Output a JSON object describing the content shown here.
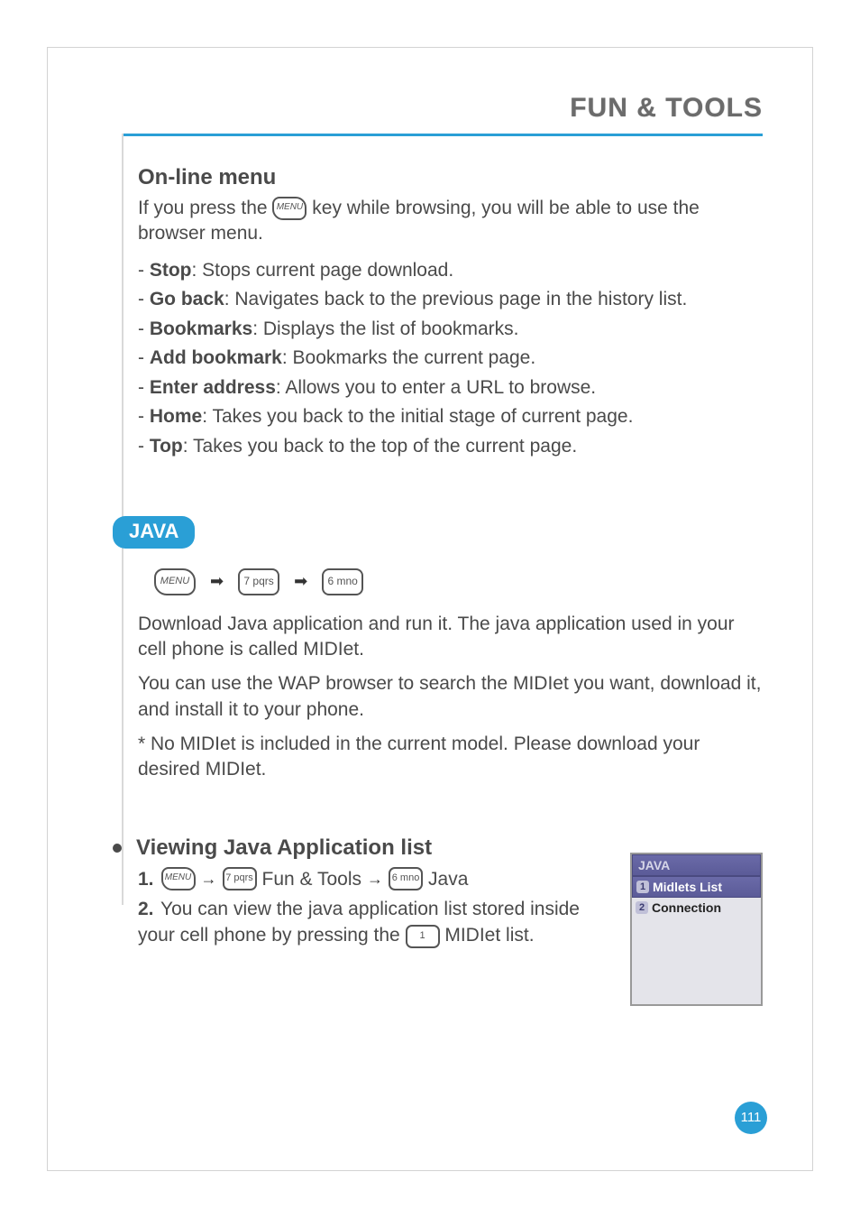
{
  "header": {
    "title": "FUN & TOOLS"
  },
  "online_menu": {
    "title": "On-line menu",
    "intro_before": "If you press the ",
    "intro_key": "MENU",
    "intro_after": " key while browsing, you will be able to use the browser menu.",
    "items": [
      {
        "name": "Stop",
        "desc": ": Stops current page download."
      },
      {
        "name": "Go back",
        "desc": ": Navigates back to the previous page in the history list."
      },
      {
        "name": "Bookmarks",
        "desc": ": Displays the list of bookmarks."
      },
      {
        "name": "Add bookmark",
        "desc": ": Bookmarks the current page."
      },
      {
        "name": "Enter address",
        "desc": ": Allows you to enter a URL to browse."
      },
      {
        "name": "Home",
        "desc": ": Takes you back to the initial stage of current page."
      },
      {
        "name": "Top",
        "desc": ": Takes you back to the top of the current page."
      }
    ]
  },
  "java": {
    "label": "JAVA",
    "keys": {
      "menu": "MENU",
      "k7": "7 pqrs",
      "k6": "6 mno"
    },
    "p1": "Download Java application and run it. The java application used in your cell phone is called MIDIet.",
    "p2": "You can use the WAP browser to search the MIDIet you want, download it, and install it to your phone.",
    "p3": "* No MIDIet is included in the current model. Please download your desired MIDIet."
  },
  "viewing": {
    "title": "Viewing Java Application list",
    "step1": {
      "num": "1.",
      "key_menu": "MENU",
      "arrow1": "→",
      "key7": "7 pqrs",
      "label1": "Fun & Tools",
      "arrow2": "→",
      "key6": "6 mno",
      "label2": "Java"
    },
    "step2": {
      "num": "2.",
      "before": "You can view the java application list stored inside your cell phone by pressing the ",
      "key1": "1",
      "after": " MIDIet list."
    }
  },
  "phone": {
    "title": "JAVA",
    "rows": [
      {
        "num": "1",
        "label": "Midlets List",
        "selected": true
      },
      {
        "num": "2",
        "label": "Connection",
        "selected": false
      }
    ]
  },
  "page_number": "111"
}
